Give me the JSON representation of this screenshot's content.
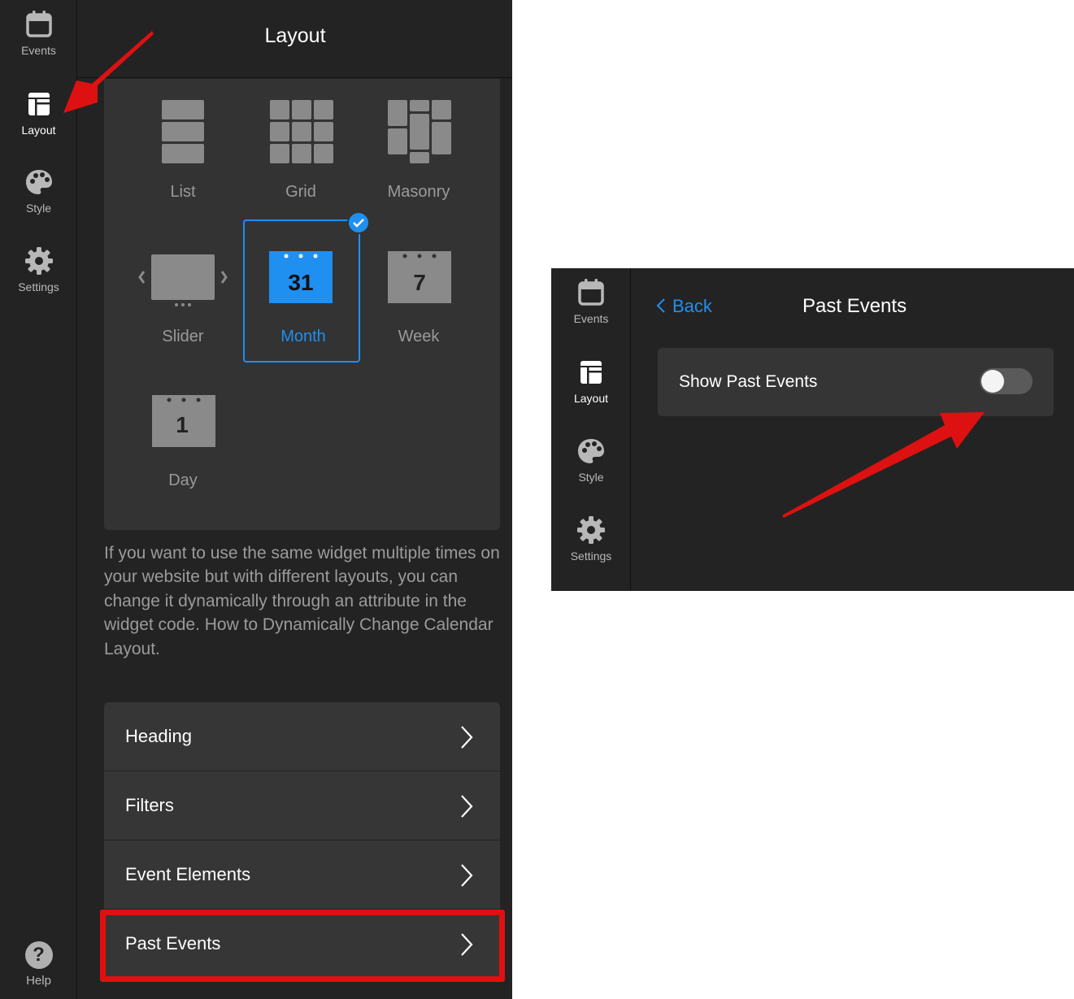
{
  "left_panel": {
    "rail": {
      "items": [
        {
          "label": "Events",
          "icon": "calendar-icon"
        },
        {
          "label": "Layout",
          "icon": "layout-icon",
          "active": true
        },
        {
          "label": "Style",
          "icon": "palette-icon"
        },
        {
          "label": "Settings",
          "icon": "gear-icon"
        }
      ],
      "help_label": "Help",
      "help_glyph": "?"
    },
    "title": "Layout",
    "layouts": [
      {
        "label": "List",
        "icon": "list-layout-icon"
      },
      {
        "label": "Grid",
        "icon": "grid-layout-icon"
      },
      {
        "label": "Masonry",
        "icon": "masonry-layout-icon"
      },
      {
        "label": "Slider",
        "icon": "slider-layout-icon"
      },
      {
        "label": "Month",
        "icon": "month-calendar-icon",
        "badge": "31",
        "selected": true
      },
      {
        "label": "Week",
        "icon": "week-calendar-icon",
        "badge": "7"
      },
      {
        "label": "Day",
        "icon": "day-calendar-icon",
        "badge": "1"
      }
    ],
    "help_text": "If you want to use the same widget multiple times on your website but with different layouts, you can change it dynamically through an attribute in the widget code. How to Dynamically Change Calendar Layout.",
    "menu": [
      {
        "label": "Heading"
      },
      {
        "label": "Filters"
      },
      {
        "label": "Event Elements"
      },
      {
        "label": "Past Events",
        "highlighted": true
      }
    ]
  },
  "right_panel": {
    "rail": {
      "items": [
        {
          "label": "Events",
          "icon": "calendar-icon"
        },
        {
          "label": "Layout",
          "icon": "layout-icon",
          "active": true
        },
        {
          "label": "Style",
          "icon": "palette-icon"
        },
        {
          "label": "Settings",
          "icon": "gear-icon"
        }
      ]
    },
    "back_label": "Back",
    "title": "Past Events",
    "toggle": {
      "label": "Show Past Events",
      "on": false
    }
  },
  "colors": {
    "panel_bg": "#232323",
    "card_bg": "#353535",
    "accent": "#1f8ff0",
    "annotation": "#e01010"
  }
}
